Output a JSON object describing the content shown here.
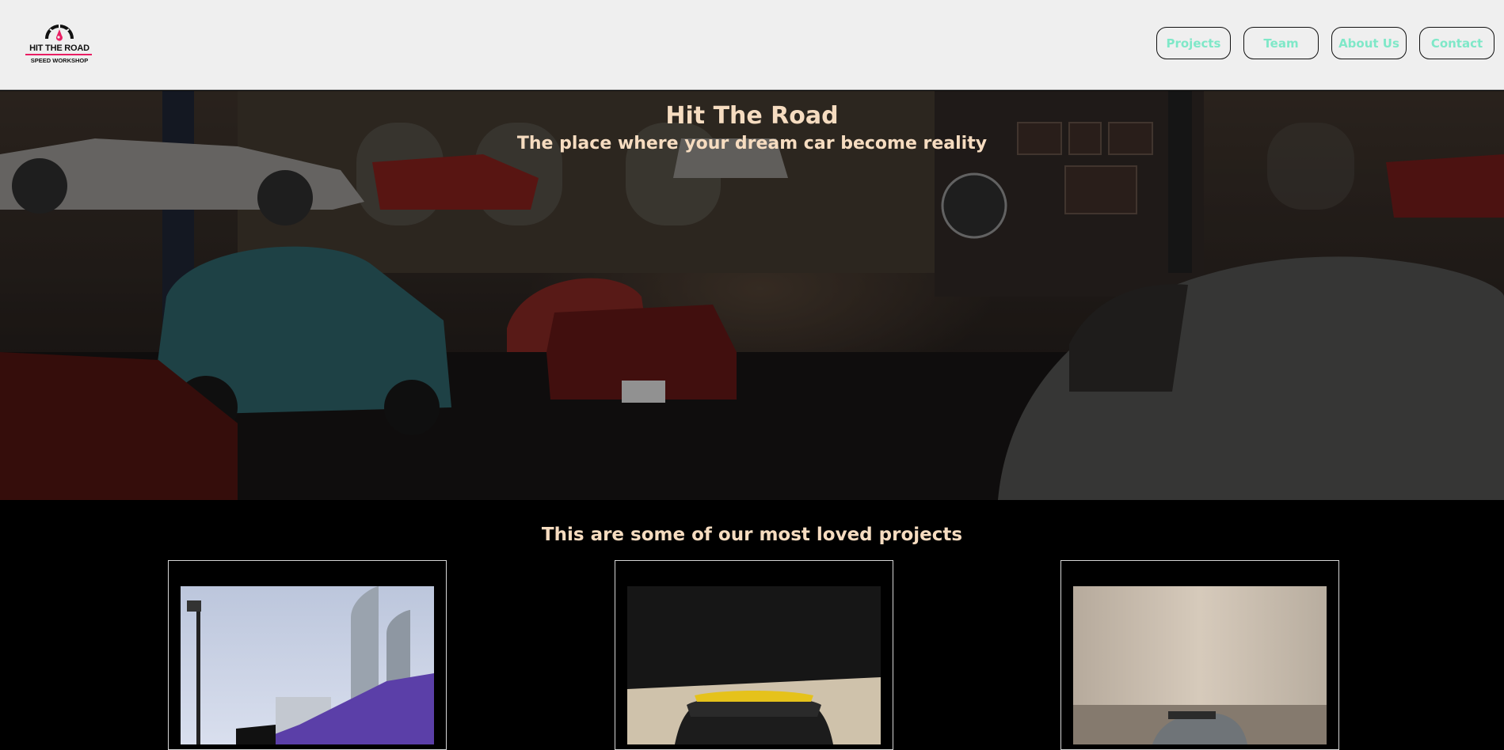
{
  "brand": {
    "name": "HIT THE ROAD",
    "tagline": "SPEED WORKSHOP",
    "accent_color": "#e91e63",
    "icon": "speedometer-icon"
  },
  "nav": {
    "items": [
      {
        "label": "Projects"
      },
      {
        "label": "Team"
      },
      {
        "label": "About Us"
      },
      {
        "label": "Contact"
      }
    ],
    "text_color": "#7fe8c8"
  },
  "hero": {
    "title": "Hit The Road",
    "subtitle": "The place where your dream car become reality",
    "text_color": "#f6dcc0"
  },
  "projects": {
    "heading": "This are some of our most loved projects"
  }
}
